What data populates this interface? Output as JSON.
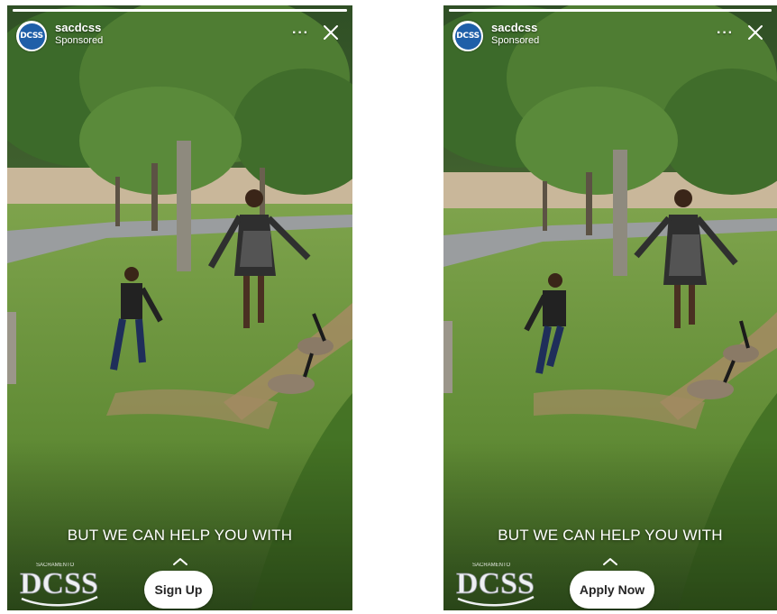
{
  "stories": [
    {
      "account": {
        "avatar_text": "DCSS",
        "name": "sacdcss",
        "sponsored_label": "Sponsored"
      },
      "more_label": "···",
      "caption": "BUT WE CAN HELP YOU WITH",
      "cta_label": "Sign Up",
      "logo": {
        "small_text": "SACRAMENTO",
        "main_text": "DCSS"
      },
      "progress": 1.0
    },
    {
      "account": {
        "avatar_text": "DCSS",
        "name": "sacdcss",
        "sponsored_label": "Sponsored"
      },
      "more_label": "···",
      "caption": "BUT WE CAN HELP YOU WITH",
      "cta_label": "Apply Now",
      "logo": {
        "small_text": "SACRAMENTO",
        "main_text": "DCSS"
      },
      "progress": 1.0
    }
  ],
  "colors": {
    "avatar_blue": "#1f5fa8",
    "cta_background": "#ffffff",
    "cta_text": "#262626"
  },
  "icons": {
    "close": "close-icon",
    "more": "more-options-icon",
    "swipe_up": "chevron-up-icon"
  }
}
